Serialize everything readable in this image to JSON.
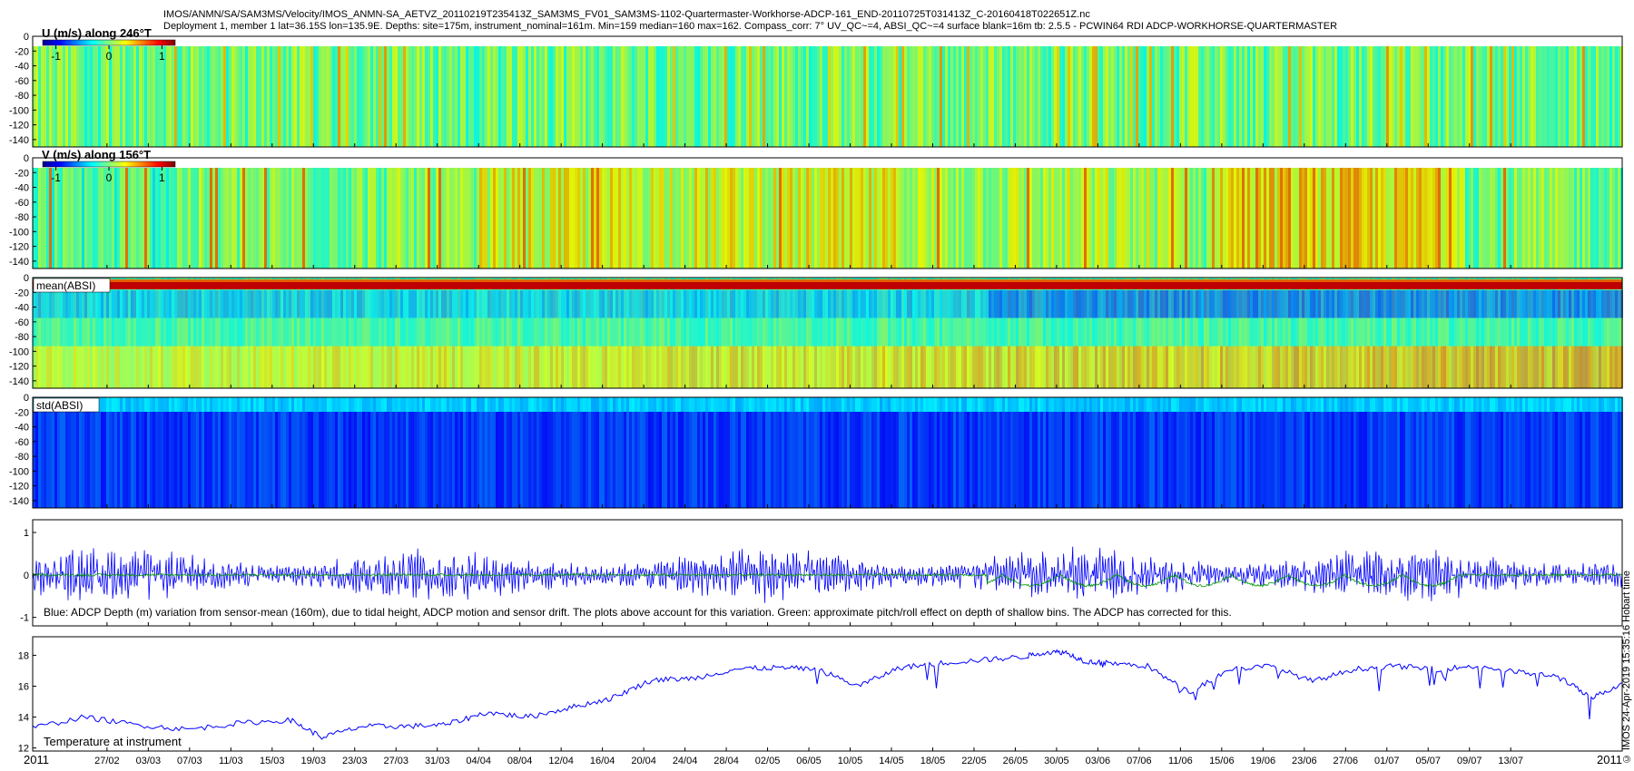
{
  "header": {
    "line1": "IMOS/ANMN/SA/SAM3MS/Velocity/IMOS_ANMN-SA_AETVZ_20110219T235413Z_SAM3MS_FV01_SAM3MS-1102-Quartermaster-Workhorse-ADCP-161_END-20110725T031413Z_C-20160418T022651Z.nc",
    "line2": "Deployment 1, member 1 lat=36.15S lon=135.9E. Depths: site=175m, instrument_nominal=161m. Min=159 median=160 max=162. Compass_corr: 7° UV_QC~=4, ABSI_QC~=4 surface blank=16m tb: 2.5.5 - PCWIN64 RDI ADCP-WORKHORSE-QUARTERMASTER"
  },
  "stamp": "© IMOS 24-Apr-2019 15:35:16 Hobart time",
  "x_axis": {
    "start_label": "2011",
    "end_label": "2011",
    "ticks": [
      "27/02",
      "03/03",
      "07/03",
      "11/03",
      "15/03",
      "19/03",
      "23/03",
      "27/03",
      "31/03",
      "04/04",
      "08/04",
      "12/04",
      "16/04",
      "20/04",
      "24/04",
      "28/04",
      "02/05",
      "06/05",
      "10/05",
      "14/05",
      "18/05",
      "22/05",
      "26/05",
      "30/05",
      "03/06",
      "07/06",
      "11/06",
      "15/06",
      "19/06",
      "23/06",
      "27/06",
      "01/07",
      "05/07",
      "09/07",
      "13/07"
    ]
  },
  "colors": {
    "u_field": "#22c322",
    "v_field": "#30c430",
    "absi_mean": "#22bb55",
    "absi_std": "#1040b8",
    "depth_line": "#0000ff",
    "pitch_roll_line": "#009900",
    "temp_line": "#0000ff"
  },
  "chart_data": [
    {
      "type": "heatmap",
      "panel": "u",
      "title": "U (m/s) along 246°T",
      "y_ticks": [
        "0",
        "-20",
        "-40",
        "-60",
        "-80",
        "-100",
        "-120",
        "-140"
      ],
      "ylim": [
        -150,
        0
      ],
      "colorbar": {
        "colormap": "jet",
        "range": [
          -1.25,
          1.25
        ],
        "ticks": [
          "-1",
          "0",
          "1"
        ]
      }
    },
    {
      "type": "heatmap",
      "panel": "v",
      "title": "V (m/s) along 156°T",
      "y_ticks": [
        "0",
        "-20",
        "-40",
        "-60",
        "-80",
        "-100",
        "-120",
        "-140"
      ],
      "ylim": [
        -150,
        0
      ],
      "colorbar": {
        "colormap": "jet",
        "range": [
          -1.25,
          1.25
        ],
        "ticks": [
          "-1",
          "0",
          "1"
        ]
      }
    },
    {
      "type": "heatmap",
      "panel": "absi_mean",
      "title": "mean(ABSI)",
      "y_ticks": [
        "0",
        "-20",
        "-40",
        "-60",
        "-80",
        "-100",
        "-120",
        "-140"
      ],
      "ylim": [
        -150,
        0
      ]
    },
    {
      "type": "heatmap",
      "panel": "absi_std",
      "title": "std(ABSI)",
      "y_ticks": [
        "0",
        "-20",
        "-40",
        "-60",
        "-80",
        "-100",
        "-120",
        "-140"
      ],
      "ylim": [
        -150,
        0
      ]
    },
    {
      "type": "line",
      "panel": "depth",
      "annotation": "Blue: ADCP Depth (m) variation from sensor-mean (160m), due to tidal height, ADCP motion and sensor drift. The plots above account for this variation. Green: approximate pitch/roll effect on depth of shallow bins. The ADCP has corrected for this.",
      "y_ticks": [
        "1",
        "0",
        "-1"
      ],
      "ylim": [
        -1.2,
        1.3
      ],
      "series": [
        {
          "name": "Blue",
          "amplitude": 0.55
        },
        {
          "name": "Green",
          "amplitude": 0.1
        }
      ]
    },
    {
      "type": "line",
      "panel": "temperature",
      "annotation": "Temperature at instrument",
      "y_ticks": [
        "18",
        "16",
        "14",
        "12"
      ],
      "ylim": [
        11.8,
        19.2
      ],
      "x_days_since_start": [
        0,
        5,
        10,
        15,
        20,
        25,
        28,
        32,
        36,
        40,
        44,
        48,
        52,
        56,
        60,
        64,
        68,
        72,
        76,
        80,
        84,
        88,
        92,
        96,
        98,
        100,
        102,
        104,
        108,
        112,
        116,
        120,
        124,
        128,
        132,
        136,
        140,
        144,
        148,
        151,
        154
      ],
      "y": [
        13.3,
        14.0,
        13.5,
        13.2,
        13.6,
        13.8,
        12.7,
        13.4,
        13.4,
        13.5,
        14.3,
        14.0,
        14.6,
        15.2,
        16.4,
        16.5,
        17.1,
        17.2,
        17.1,
        16.0,
        17.2,
        17.5,
        17.7,
        17.9,
        18.2,
        18.2,
        17.6,
        17.5,
        17.3,
        15.6,
        17.1,
        17.3,
        16.3,
        17.1,
        17.3,
        17.1,
        17.3,
        16.9,
        16.6,
        15.2,
        16.2
      ]
    }
  ]
}
